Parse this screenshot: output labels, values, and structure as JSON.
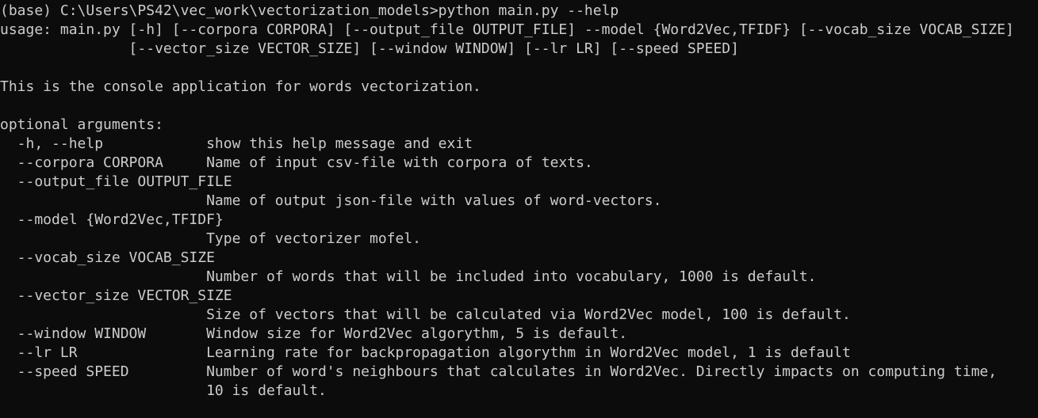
{
  "terminal": {
    "lines": [
      "(base) C:\\Users\\PS42\\vec_work\\vectorization_models>python main.py --help",
      "usage: main.py [-h] [--corpora CORPORA] [--output_file OUTPUT_FILE] --model {Word2Vec,TFIDF} [--vocab_size VOCAB_SIZE]",
      "               [--vector_size VECTOR_SIZE] [--window WINDOW] [--lr LR] [--speed SPEED]",
      "",
      "This is the console application for words vectorization.",
      "",
      "optional arguments:",
      "  -h, --help            show this help message and exit",
      "  --corpora CORPORA     Name of input csv-file with corpora of texts.",
      "  --output_file OUTPUT_FILE",
      "                        Name of output json-file with values of word-vectors.",
      "  --model {Word2Vec,TFIDF}",
      "                        Type of vectorizer mofel.",
      "  --vocab_size VOCAB_SIZE",
      "                        Number of words that will be included into vocabulary, 1000 is default.",
      "  --vector_size VECTOR_SIZE",
      "                        Size of vectors that will be calculated via Word2Vec model, 100 is default.",
      "  --window WINDOW       Window size for Word2Vec algorythm, 5 is default.",
      "  --lr LR               Learning rate for backpropagation algorythm in Word2Vec model, 1 is default",
      "  --speed SPEED         Number of word's neighbours that calculates in Word2Vec. Directly impacts on computing time,",
      "                        10 is default."
    ]
  },
  "colors": {
    "background": "#0c0c0c",
    "foreground": "#cccccc"
  }
}
